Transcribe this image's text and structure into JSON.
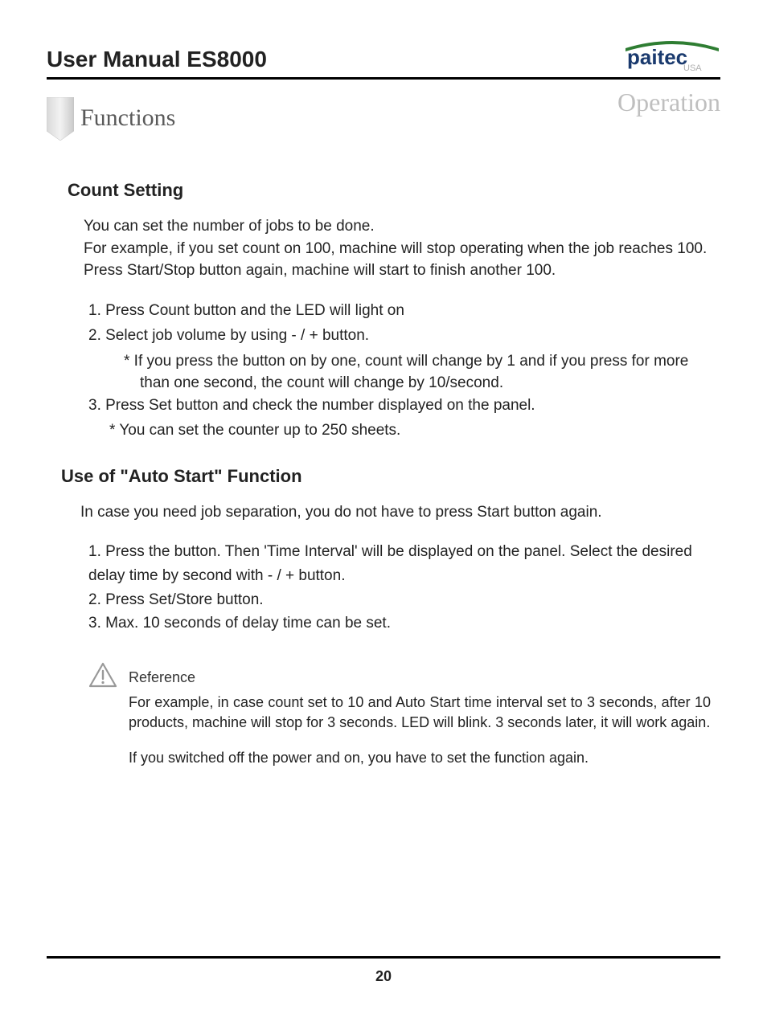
{
  "header": {
    "manual_title": "User Manual ES8000",
    "logo_text_brand": "paitec",
    "logo_text_sub": "USA"
  },
  "section_label": "Operation",
  "functions_title": "Functions",
  "count_setting": {
    "heading": "Count Setting",
    "intro": "You can set the number of jobs to be done.\nFor example, if you set count on 100, machine will stop operating when the job reaches 100.  Press Start/Stop button again, machine will start to finish another 100.",
    "steps": [
      "1.  Press Count button and the LED will light on",
      "2.  Select job volume by using - / + button.",
      "3.  Press Set button and check the number displayed on the panel."
    ],
    "step2_sub": "*  If you press the button on by one, count will change by 1 and if you press for more than one second, the count will change by 10/second.",
    "step3_sub": "*  You can set the counter up to 250 sheets."
  },
  "auto_start": {
    "heading": "Use of \"Auto Start\" Function",
    "intro": "In case you need job separation, you do not have to press Start button again.",
    "step1a": "1.  Press the button.  Then 'Time Interval' will be displayed on the panel.  Select the desired",
    "step1b": "delay time by second with - / + button.",
    "step2": "2.  Press Set/Store button.",
    "step3": "3.  Max. 10 seconds of delay time can be set."
  },
  "reference": {
    "label": "Reference",
    "p1": "For example, in case count set to 10 and Auto Start time interval set to 3 seconds, after 10 products, machine will stop for 3 seconds.  LED will blink. 3 seconds later, it will work again.",
    "p2": "If you switched off the power and on, you have to set the function again."
  },
  "page_number": "20"
}
